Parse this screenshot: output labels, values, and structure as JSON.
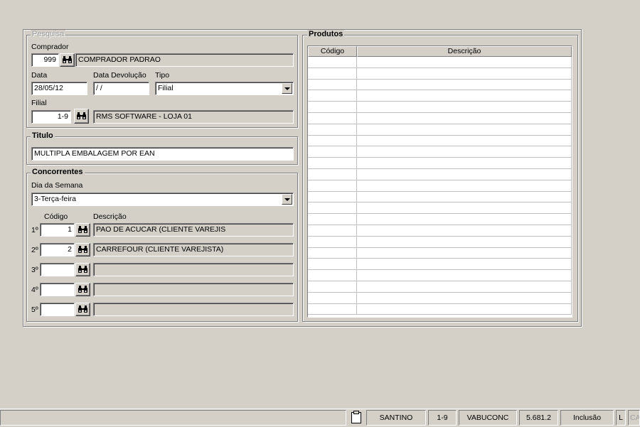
{
  "pesquisa": {
    "legend": "Pesquisa",
    "comprador_label": "Comprador",
    "comprador_code": "999",
    "comprador_name": "COMPRADOR PADRAO",
    "data_label": "Data",
    "data_value": "28/05/12",
    "devolucao_label": "Data Devolução",
    "devolucao_value": " / /",
    "tipo_label": "Tipo",
    "tipo_value": "Filial",
    "filial_label": "Filial",
    "filial_code": "1-9",
    "filial_name": "RMS SOFTWARE - LOJA 01"
  },
  "titulo": {
    "legend": "Titulo",
    "value": "MULTIPLA EMBALAGEM POR EAN"
  },
  "concorrentes": {
    "legend": "Concorrentes",
    "dia_label": "Dia da Semana",
    "dia_value": "3-Terça-feira",
    "codigo_header": "Código",
    "descricao_header": "Descrição",
    "rows": [
      {
        "label": "1º",
        "code": "1",
        "name": "PAO DE ACUCAR (CLIENTE VAREJIS"
      },
      {
        "label": "2º",
        "code": "2",
        "name": "CARREFOUR (CLIENTE VAREJISTA)"
      },
      {
        "label": "3º",
        "code": "",
        "name": ""
      },
      {
        "label": "4º",
        "code": "",
        "name": ""
      },
      {
        "label": "5º",
        "code": "",
        "name": ""
      }
    ]
  },
  "produtos": {
    "legend": "Produtos",
    "col_codigo": "Código",
    "col_descricao": "Descrição"
  },
  "status_bar": {
    "user": "SANTINO",
    "store": "1-9",
    "program": "VABUCONC",
    "version": "5.681.2",
    "mode": "Inclusão",
    "flag": "L",
    "extra": "CA"
  },
  "icons": {
    "lookup": "binoculars-icon",
    "clipboard": "clipboard-icon"
  }
}
